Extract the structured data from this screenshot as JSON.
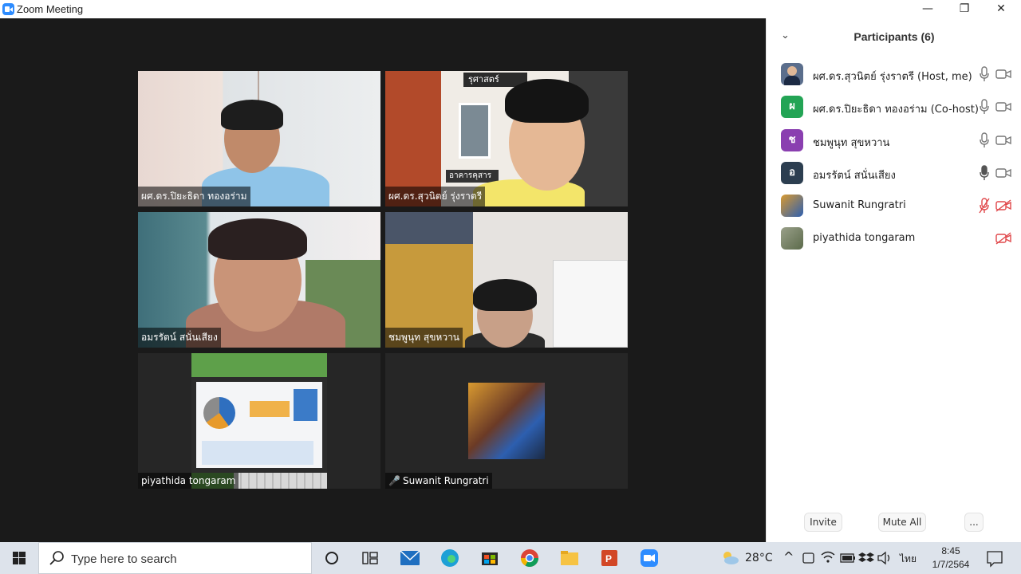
{
  "window": {
    "title": "Zoom Meeting",
    "minimize_glyph": "—",
    "restore_glyph": "❐",
    "close_glyph": "✕"
  },
  "video_tiles": [
    {
      "name": "ผศ.ดร.ปิยะธิดา ทองอร่าม",
      "muted": false,
      "active": false
    },
    {
      "name": "ผศ.ดร.สุวนิตย์ รุ่งราตรี",
      "muted": false,
      "active": false
    },
    {
      "name": "อมรรัตน์  สนั่นเสียง",
      "muted": false,
      "active": true
    },
    {
      "name": "ชมพูนุท  สุขหวาน",
      "muted": false,
      "active": false
    },
    {
      "name": "piyathida tongaram",
      "muted": false,
      "active": false
    },
    {
      "name": "Suwanit Rungratri",
      "muted": true,
      "active": false
    }
  ],
  "tile_scene_text": "อาคารคุสาร",
  "tile_scene_sign": "รุศาสตร์",
  "participants_panel": {
    "collapse_glyph": "⌄",
    "title": "Participants (6)",
    "participants": [
      {
        "avatar": "photo",
        "avatar_color": "#5b6e8c",
        "name": "ผศ.ดร.สุวนิตย์ รุ่งราตรี (Host, me)",
        "mic": "on",
        "video": "on"
      },
      {
        "avatar": "ผ",
        "avatar_color": "#23a455",
        "name": "ผศ.ดร.ปิยะธิดา ทองอร่าม (Co-host)",
        "mic": "on",
        "video": "on"
      },
      {
        "avatar": "ช",
        "avatar_color": "#8a3fb0",
        "name": "ชมพูนุท  สุขหวาน",
        "mic": "on",
        "video": "on"
      },
      {
        "avatar": "อ",
        "avatar_color": "#2c3e50",
        "name": "อมรรัตน์  สนั่นเสียง",
        "mic": "active",
        "video": "on"
      },
      {
        "avatar": "photo",
        "avatar_color": "#4a7aa8",
        "name": "Suwanit Rungratri",
        "mic": "muted",
        "video": "off"
      },
      {
        "avatar": "photo",
        "avatar_color": "#7a8a6a",
        "name": "piyathida tongaram",
        "mic": "none",
        "video": "off"
      }
    ],
    "invite_label": "Invite",
    "mute_all_label": "Mute All",
    "more_label": "..."
  },
  "taskbar": {
    "search_placeholder": "Type here to search",
    "weather": "28°C",
    "language": "ไทย",
    "time": "8:45",
    "date": "1/7/2564",
    "accent": "#3a78c4"
  }
}
